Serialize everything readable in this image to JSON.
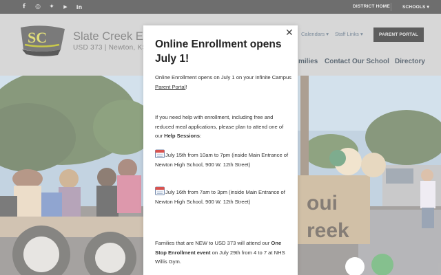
{
  "topbar": {
    "social": [
      {
        "name": "facebook",
        "glyph": "f"
      },
      {
        "name": "instagram",
        "glyph": "◎"
      },
      {
        "name": "twitter",
        "glyph": "✦"
      },
      {
        "name": "youtube",
        "glyph": "▶"
      },
      {
        "name": "linkedin",
        "glyph": "in"
      }
    ],
    "district_home": "DISTRICT HOME",
    "schools": "SCHOOLS ▾"
  },
  "header": {
    "logo_letters": "SC",
    "school_name": "Slate Creek Ele",
    "school_sub": "USD 373 | Newton, KS",
    "calendars": "Calendars ▾",
    "staff_links": "Staff Links ▾",
    "parent_portal": "PARENT PORTAL",
    "nav": {
      "families": "milies",
      "contact": "Contact Our School",
      "directory": "Directory"
    }
  },
  "modal": {
    "close": "✕",
    "title": "Online Enrollment opens July 1!",
    "p1_before": "Online Enrollment opens on July 1 on your Infinite Campus ",
    "p1_link": "Parent Portal",
    "p1_after": "!",
    "p2_before": "If you need help with enrollment, including free and reduced meal applications, please plan to attend one of our ",
    "p2_bold": "Help Sessions",
    "p2_after": ":",
    "session1": "July 15th from 10am to 7pm (inside Main Entrance of Newton High School, 900 W. 12th Street)",
    "session2": "July 16th from 7am to 3pm (inside Main Entrance of Newton High School, 900 W. 12th Street)",
    "p3_before": "Families that are NEW to USD 373 will attend our ",
    "p3_bold": "One Stop Enrollment event",
    "p3_after": " on July 29th from 4 to 7 at NHS Willis Gym."
  },
  "colors": {
    "topbar": "#6e6e6e",
    "header": "#d7d7d7",
    "button": "#5d5d5d",
    "nav": "#5f6b76"
  }
}
